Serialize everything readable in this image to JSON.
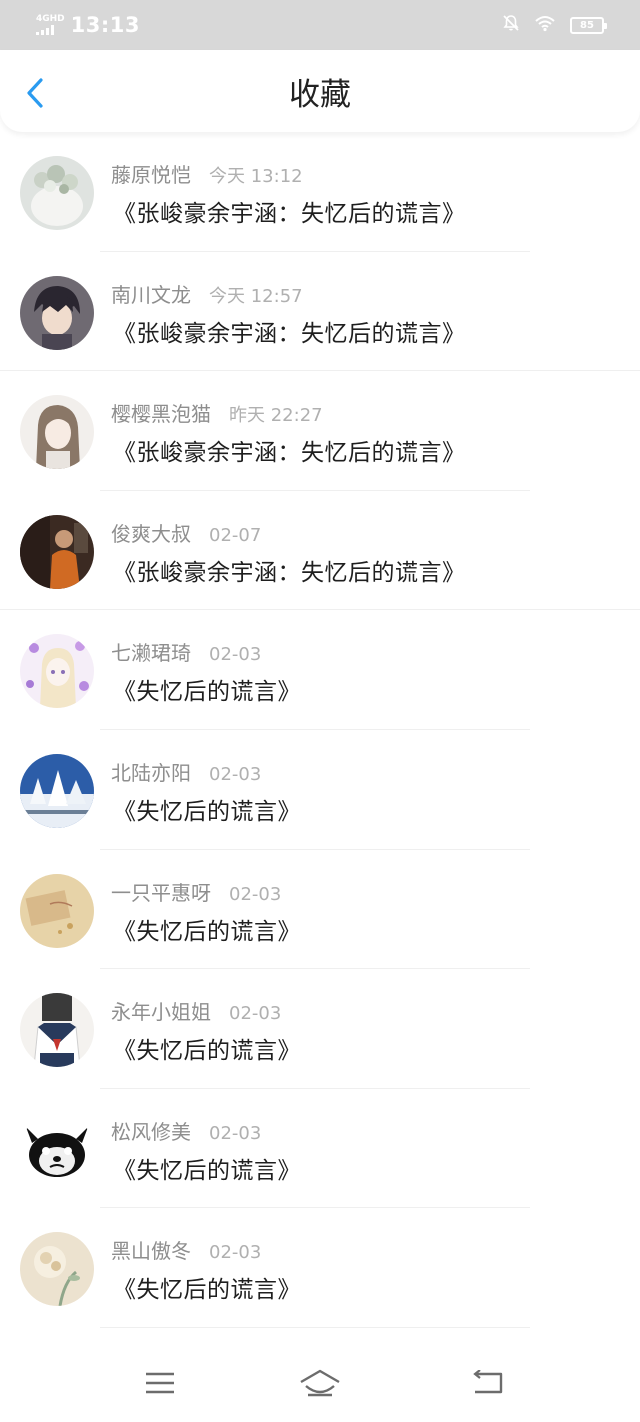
{
  "status_bar": {
    "network": "4GHD",
    "time": "13:13",
    "battery": "85"
  },
  "header": {
    "title": "收藏",
    "back_icon": "chevron-left-icon",
    "accent_color": "#2a9bf0"
  },
  "items": [
    {
      "username": "藤原悦恺",
      "time": "今天 13:12",
      "message": "《张峻豪余宇涵：失忆后的谎言》"
    },
    {
      "username": "南川文龙",
      "time": "今天 12:57",
      "message": "《张峻豪余宇涵：失忆后的谎言》"
    },
    {
      "username": "樱樱黑泡猫",
      "time": "昨天 22:27",
      "message": "《张峻豪余宇涵：失忆后的谎言》"
    },
    {
      "username": "俊爽大叔",
      "time": "02-07",
      "message": "《张峻豪余宇涵：失忆后的谎言》"
    },
    {
      "username": "七濑珺琦",
      "time": "02-03",
      "message": "《失忆后的谎言》"
    },
    {
      "username": "北陆亦阳",
      "time": "02-03",
      "message": "《失忆后的谎言》"
    },
    {
      "username": "一只平惠呀",
      "time": "02-03",
      "message": "《失忆后的谎言》"
    },
    {
      "username": "永年小姐姐",
      "time": "02-03",
      "message": "《失忆后的谎言》"
    },
    {
      "username": "松风修美",
      "time": "02-03",
      "message": "《失忆后的谎言》"
    },
    {
      "username": "黑山傲冬",
      "time": "02-03",
      "message": "《失忆后的谎言》"
    }
  ],
  "bottom_nav": [
    "menu-icon",
    "home-icon",
    "back-icon"
  ]
}
